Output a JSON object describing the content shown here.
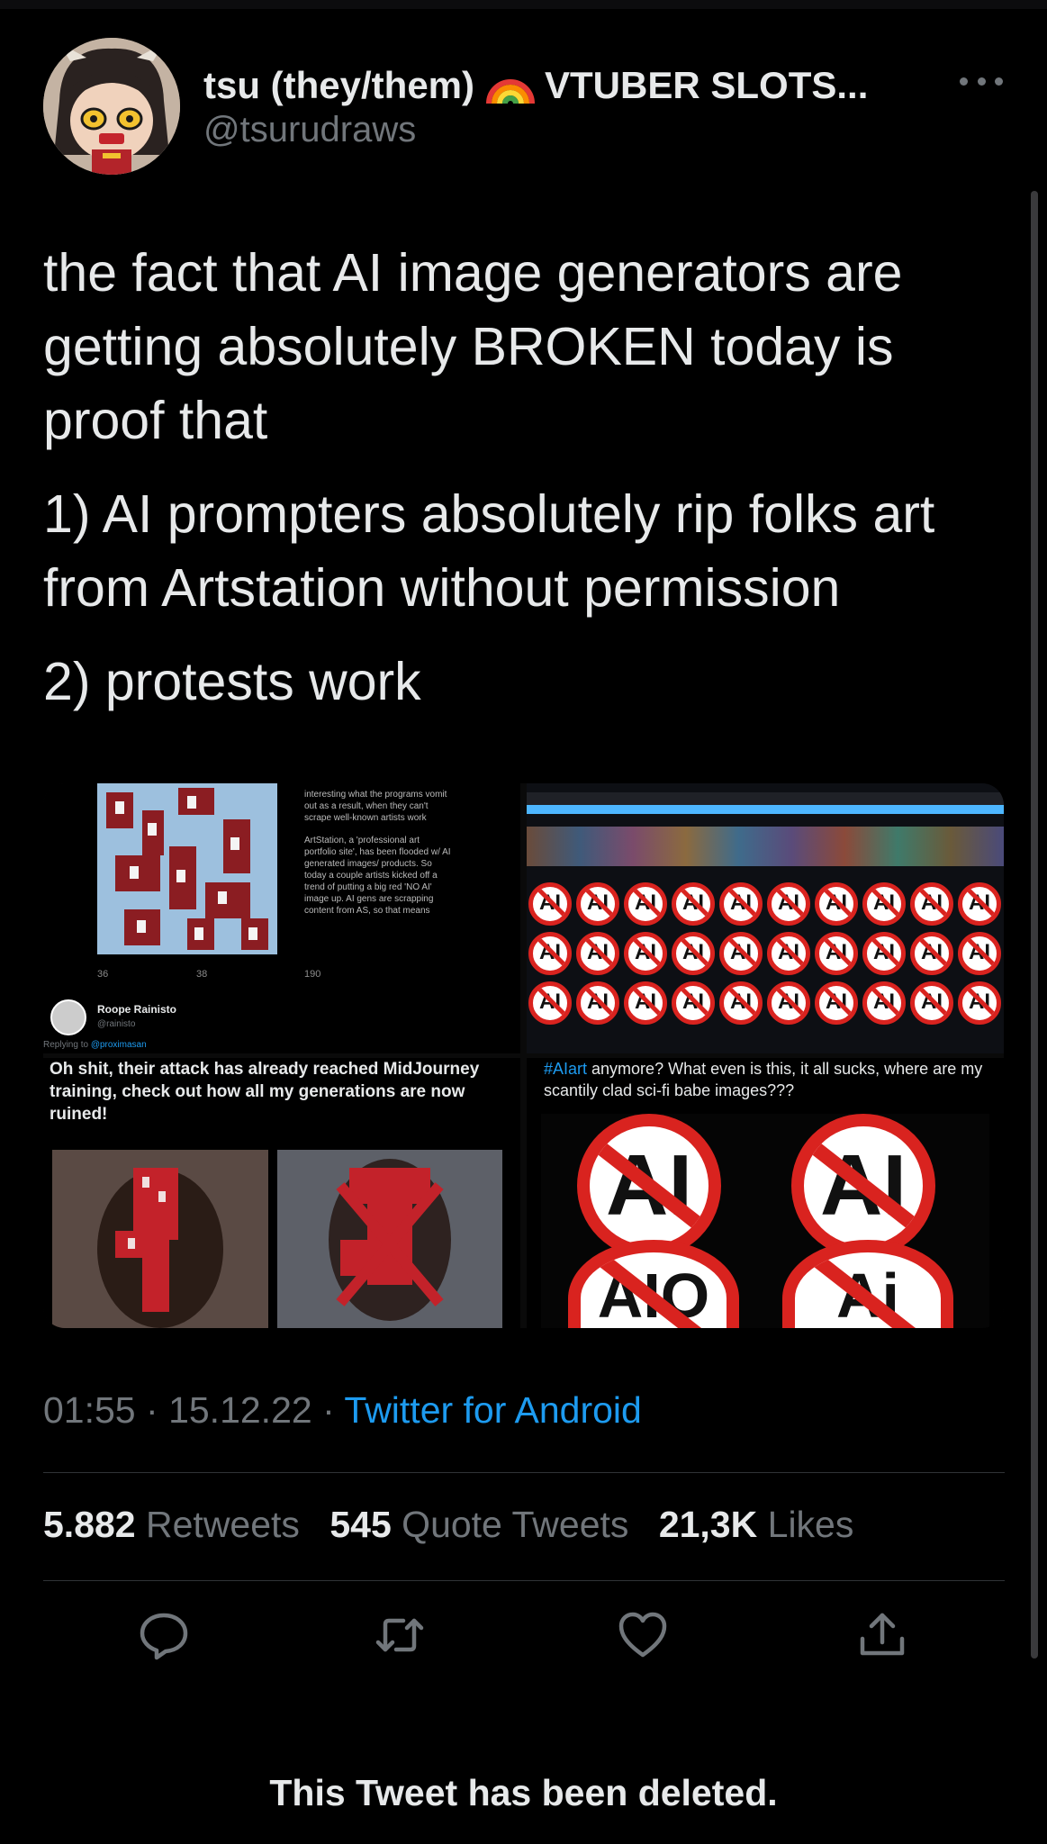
{
  "author": {
    "display_name": "tsu (they/them)",
    "name_suffix": "VTUBER SLOTS...",
    "handle": "@tsurudraws",
    "avatar_icon": "anime-avatar",
    "badge_icon": "rainbow-emoji-icon"
  },
  "tweet": {
    "paragraphs": [
      "the fact that AI image generators are getting absolutely BROKEN today is proof that",
      "1) AI prompters absolutely rip folks art from Artstation without permission",
      "2) protests work"
    ]
  },
  "media": {
    "embed_1": {
      "text_lines": [
        "interesting what the programs vomit",
        "out as a result, when they can't",
        "scrape well-known artists work",
        "ArtStation, a 'professional art",
        "portfolio site', has been flooded w/ AI",
        "generated images/ products. So",
        "today a couple artists kicked off a",
        "trend of putting a big red 'NO AI'",
        "image up. AI gens are scrapping",
        "content from AS, so that means"
      ],
      "counts": [
        "36",
        "38",
        "190"
      ]
    },
    "embed_2": {
      "user_name": "Roope Rainisto",
      "user_handle": "@rainisto",
      "replying_to_label": "Replying to",
      "replying_to": "@proximasan",
      "body": "Oh shit, their attack has already reached MidJourney training, check out how all my generations are now ruined!"
    },
    "embed_3": {
      "hashtag": "#AIart",
      "body": " anymore? What even is this, it all sucks, where are my scantily clad sci-fi babe images???",
      "badges": [
        "AI",
        "AI",
        "AIO",
        "Ai"
      ]
    }
  },
  "meta": {
    "time": "01:55",
    "date": "15.12.22",
    "separator": "·",
    "source": "Twitter for Android"
  },
  "stats": {
    "retweets_count": "5.882",
    "retweets_label": "Retweets",
    "quotes_count": "545",
    "quotes_label": "Quote Tweets",
    "likes_count": "21,3K",
    "likes_label": "Likes"
  },
  "footer": {
    "deleted_notice": "This Tweet has been deleted."
  },
  "colors": {
    "background": "#000000",
    "text": "#e7e9ea",
    "muted": "#71767b",
    "link": "#1d9bf0",
    "no_ai_red": "#d9231f"
  }
}
